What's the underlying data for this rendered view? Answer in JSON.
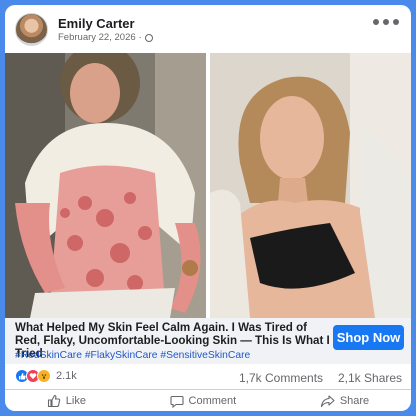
{
  "post": {
    "author": "Emily Carter",
    "date": "February 22, 2026",
    "audience_icon": "globe-icon",
    "menu_icon": "more-options-icon"
  },
  "ad": {
    "headline": "What Helped My Skin Feel Calm Again. I Was Tired of Red, Flaky, Uncomfortable-Looking Skin — This Is What I Tried",
    "hashtags": "#RedSkinCare #FlakySkinCare #SensitiveSkinCare",
    "cta_label": "Shop Now"
  },
  "stats": {
    "reaction_count": "2.1k",
    "comments": "1,7k Comments",
    "shares": "2,1k Shares"
  },
  "actions": {
    "like": "Like",
    "comment": "Comment",
    "share": "Share"
  },
  "colors": {
    "frame": "#4a8aea",
    "cta": "#1877f2",
    "hashtag": "#1f57c7",
    "caption_bg": "#f0f2f5"
  }
}
